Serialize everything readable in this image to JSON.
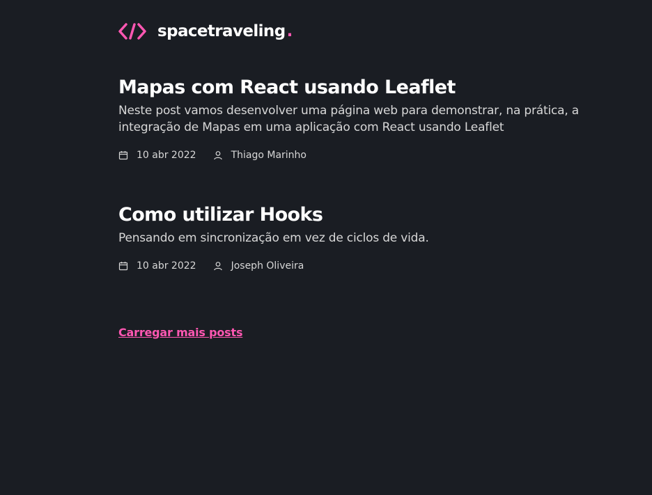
{
  "header": {
    "logo_icon": "code-brackets-icon",
    "logo_text": "spacetraveling",
    "logo_dot": "."
  },
  "posts": [
    {
      "title": "Mapas com React usando Leaflet",
      "subtitle": "Neste post vamos desenvolver uma página web para demonstrar, na prática, a integração de Mapas em uma aplicação com React usando Leaflet",
      "date": "10 abr 2022",
      "author": "Thiago Marinho",
      "date_icon": "calendar-icon",
      "author_icon": "user-icon"
    },
    {
      "title": "Como utilizar Hooks",
      "subtitle": "Pensando em sincronização em vez de ciclos de vida.",
      "date": "10 abr 2022",
      "author": "Joseph Oliveira",
      "date_icon": "calendar-icon",
      "author_icon": "user-icon"
    }
  ],
  "load_more": "Carregar mais posts",
  "colors": {
    "background": "#1a1d23",
    "accent": "#ff57b2",
    "heading": "#ffffff",
    "body_text": "#d7d7d7"
  }
}
